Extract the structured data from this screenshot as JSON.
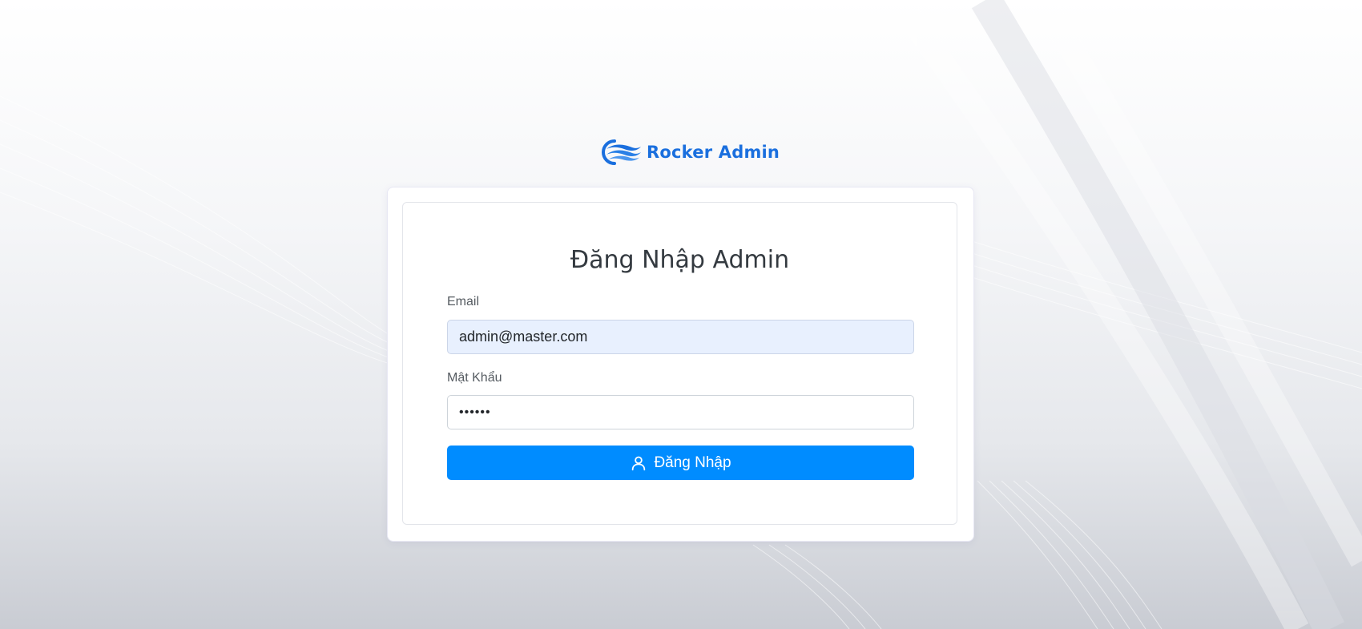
{
  "brand": {
    "name": "Rocker Admin",
    "logo_icon": "wave-logo-icon",
    "color": "#1a6fde"
  },
  "login": {
    "title": "Đăng Nhập Admin",
    "email_label": "Email",
    "email_value": "admin@master.com",
    "password_label": "Mật Khẩu",
    "password_value": "••••••",
    "submit_label": "Đăng Nhập",
    "submit_icon": "user-icon",
    "accent_color": "#008cff"
  }
}
